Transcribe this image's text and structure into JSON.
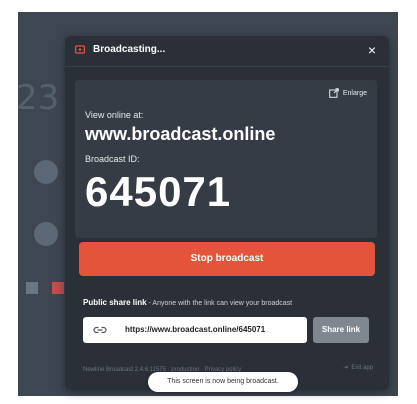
{
  "background": {
    "big_number": "23"
  },
  "modal": {
    "title": "Broadcasting...",
    "close_label": "×",
    "enlarge_label": "Enlarge",
    "view_online_label": "View online at:",
    "url": "www.broadcast.online",
    "broadcast_id_label": "Broadcast ID:",
    "broadcast_id": "645071",
    "stop_button": "Stop broadcast",
    "share_label": "Public share link",
    "share_hint": " - Anyone with the link can view your broadcast",
    "share_url": "https://www.broadcast.online/645071",
    "share_button": "Share link",
    "footer_left": "Newline Broadcast 2.4.6.11575 · production · Privacy policy",
    "footer_right": "Exit app"
  },
  "toast": {
    "text": "This screen is now being broadcast."
  },
  "colors": {
    "accent": "#e4543b",
    "modal_bg": "#2b3038",
    "panel_bg": "#363c45"
  }
}
